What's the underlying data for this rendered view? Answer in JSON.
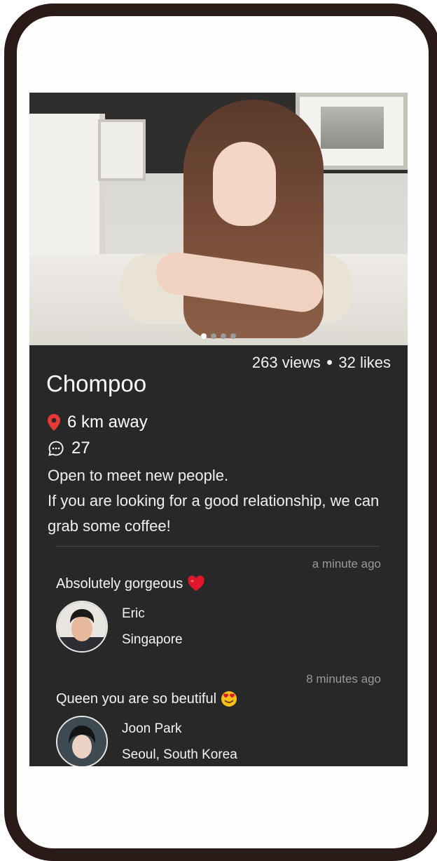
{
  "profile": {
    "name": "Chompoo",
    "views": "263 views",
    "likes": "32 likes",
    "distance": "6 km away",
    "comment_count": "27",
    "bio_line1": "Open to meet new people.",
    "bio_line2": "If you are looking for a good relationship, we can grab some coffee!"
  },
  "carousel": {
    "total": 4,
    "active_index": 0
  },
  "comments": [
    {
      "time": "a minute ago",
      "text": "Absolutely gorgeous",
      "emoji_icon": "heart-emoji",
      "user": "Eric",
      "location": "Singapore"
    },
    {
      "time": "8 minutes ago",
      "text": "Queen you are so beutiful",
      "emoji_icon": "heart-eyes-emoji",
      "user": "Joon Park",
      "location": "Seoul, South Korea"
    }
  ],
  "colors": {
    "background": "#282828",
    "pin": "#e53935",
    "heart": "#e0162b",
    "emoji_face": "#f7c21a"
  }
}
